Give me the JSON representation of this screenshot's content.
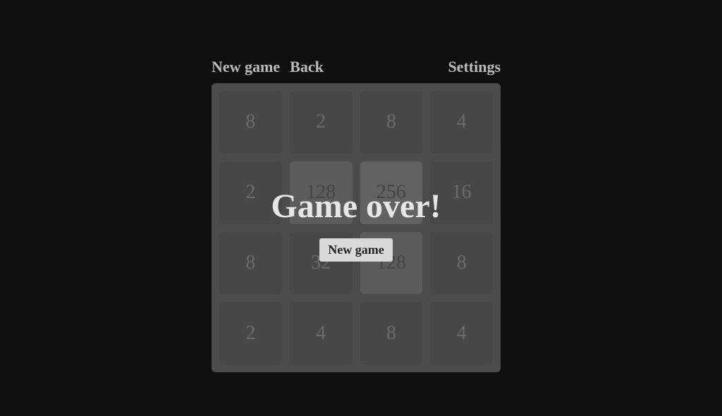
{
  "menu": {
    "new_game": "New game",
    "back": "Back",
    "settings": "Settings"
  },
  "board": {
    "size": 4,
    "tiles": [
      {
        "value": 8,
        "class": ""
      },
      {
        "value": 2,
        "class": ""
      },
      {
        "value": 8,
        "class": ""
      },
      {
        "value": 4,
        "class": ""
      },
      {
        "value": 2,
        "class": ""
      },
      {
        "value": 128,
        "class": "mid"
      },
      {
        "value": 256,
        "class": "high"
      },
      {
        "value": 16,
        "class": ""
      },
      {
        "value": 8,
        "class": ""
      },
      {
        "value": 32,
        "class": ""
      },
      {
        "value": 128,
        "class": "mid"
      },
      {
        "value": 8,
        "class": ""
      },
      {
        "value": 2,
        "class": ""
      },
      {
        "value": 4,
        "class": ""
      },
      {
        "value": 8,
        "class": ""
      },
      {
        "value": 4,
        "class": ""
      }
    ]
  },
  "overlay": {
    "message": "Game over!",
    "button": "New game"
  }
}
